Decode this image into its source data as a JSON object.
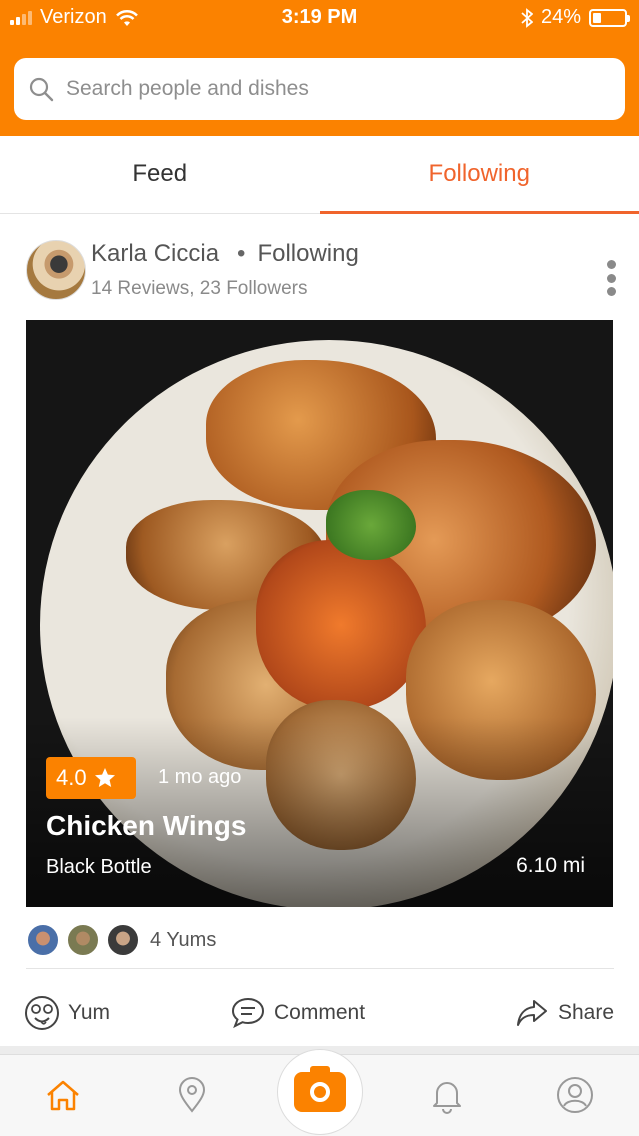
{
  "status_bar": {
    "carrier": "Verizon",
    "time": "3:19 PM",
    "battery": "24%",
    "battery_level": 0.24
  },
  "search": {
    "placeholder": "Search people and dishes"
  },
  "tabs": [
    {
      "label": "Feed",
      "active": false
    },
    {
      "label": "Following",
      "active": true
    }
  ],
  "post": {
    "user": {
      "name": "Karla Ciccia",
      "relation": "Following",
      "reviews": "14 Reviews,",
      "followers": "23 Followers"
    },
    "rating": "4.0",
    "time_ago": "1 mo ago",
    "dish": "Chicken Wings",
    "restaurant": "Black Bottle",
    "distance": "6.10 mi",
    "yums": "4 Yums"
  },
  "actions": {
    "yum": "Yum",
    "comment": "Comment",
    "share": "Share"
  },
  "bottom_nav": {
    "items": [
      "home-icon",
      "location-pin-icon",
      "camera-icon",
      "bell-icon",
      "profile-icon"
    ],
    "active": "home-icon"
  },
  "colors": {
    "brand_orange": "#fb8200",
    "tab_active": "#f0642c"
  }
}
